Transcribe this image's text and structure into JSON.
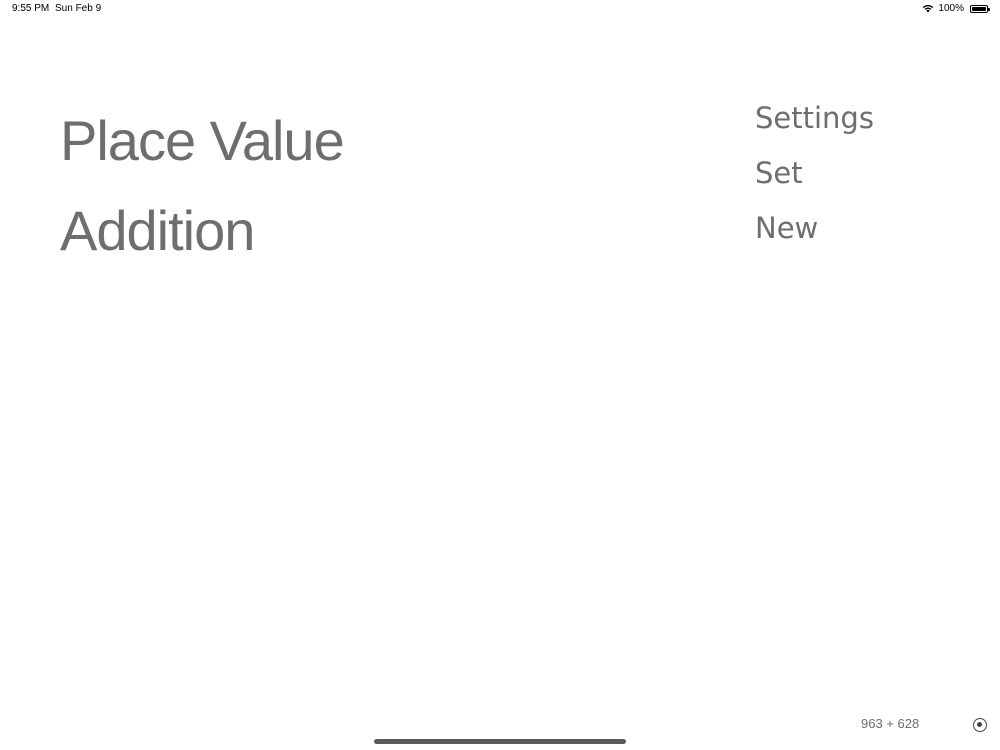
{
  "status_bar": {
    "time": "9:55 PM",
    "date": "Sun Feb 9",
    "battery_percent": "100%",
    "battery_level": 1.0,
    "wifi_icon": "wifi-icon",
    "battery_icon": "battery-icon"
  },
  "title": {
    "line1": "Place Value",
    "line2": "Addition"
  },
  "menu": {
    "items": [
      {
        "label": "Settings"
      },
      {
        "label": "Set"
      },
      {
        "label": "New"
      }
    ]
  },
  "footer": {
    "problem": "963 + 628",
    "record_icon": "record-icon"
  },
  "colors": {
    "text": "#6e6e6e",
    "background": "#ffffff"
  }
}
